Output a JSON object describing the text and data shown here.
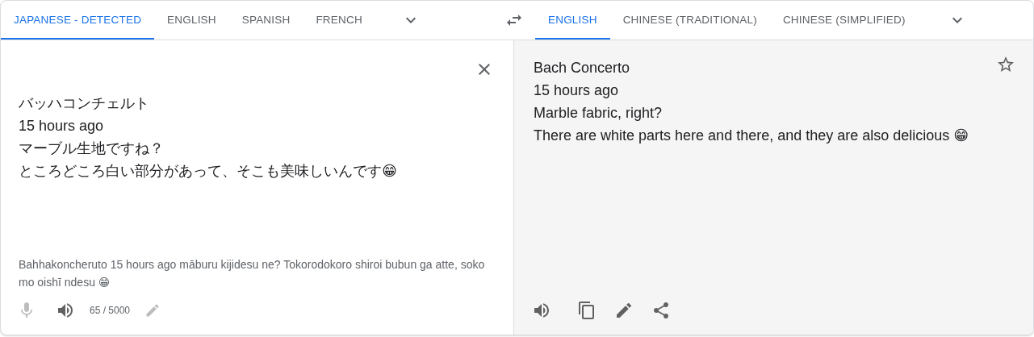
{
  "source_languages": [
    {
      "label": "JAPANESE - DETECTED",
      "selected": true
    },
    {
      "label": "ENGLISH",
      "selected": false
    },
    {
      "label": "SPANISH",
      "selected": false
    },
    {
      "label": "FRENCH",
      "selected": false
    }
  ],
  "target_languages": [
    {
      "label": "ENGLISH",
      "selected": true
    },
    {
      "label": "CHINESE (TRADITIONAL)",
      "selected": false
    },
    {
      "label": "CHINESE (SIMPLIFIED)",
      "selected": false
    }
  ],
  "source": {
    "lines": [
      "バッハコンチェルト",
      "15 hours ago",
      "マーブル生地ですね？",
      "ところどころ白い部分があって、そこも美味しいんです😁"
    ],
    "romanization": "Bahhakoncheruto 15 hours ago māburu kijidesu ne? Tokorodokoro shiroi bubun ga atte, soko mo oishī ndesu 😁",
    "char_count": "65 / 5000"
  },
  "translation": {
    "lines": [
      "Bach Concerto",
      "15 hours ago",
      "Marble fabric, right?",
      "There are white parts here and there, and they are also delicious 😁"
    ]
  }
}
